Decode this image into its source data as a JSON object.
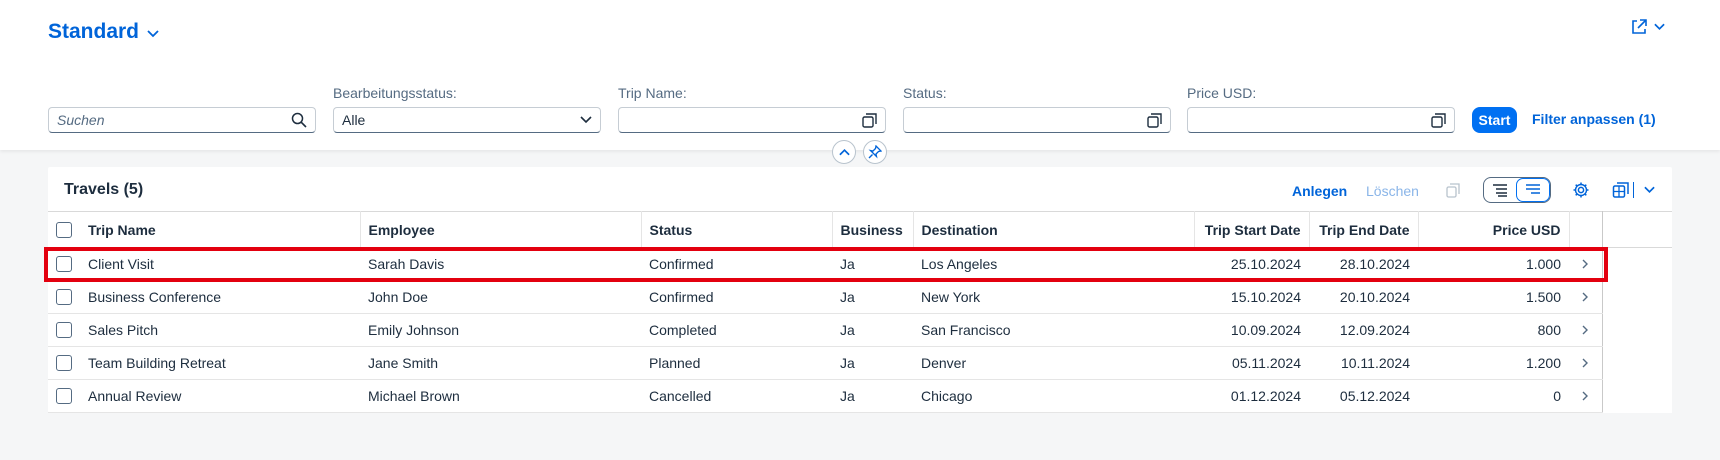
{
  "header": {
    "variant_title": "Standard",
    "share_icon": "share-icon"
  },
  "filters": {
    "search": {
      "placeholder": "Suchen"
    },
    "editing_status": {
      "label": "Bearbeitungsstatus:",
      "value": "Alle"
    },
    "trip_name": {
      "label": "Trip Name:",
      "value": ""
    },
    "status": {
      "label": "Status:",
      "value": ""
    },
    "price_usd": {
      "label": "Price USD:",
      "value": ""
    },
    "go_label": "Start",
    "adapt_label": "Filter anpassen (1)"
  },
  "table": {
    "title": "Travels (5)",
    "actions": {
      "create": "Anlegen",
      "delete": "Löschen"
    },
    "columns": [
      "Trip Name",
      "Employee",
      "Status",
      "Business",
      "Destination",
      "Trip Start Date",
      "Trip End Date",
      "Price USD"
    ],
    "rows": [
      {
        "trip_name": "Client Visit",
        "employee": "Sarah Davis",
        "status": "Confirmed",
        "business": "Ja",
        "destination": "Los Angeles",
        "start": "25.10.2024",
        "end": "28.10.2024",
        "price": "1.000"
      },
      {
        "trip_name": "Business Conference",
        "employee": "John Doe",
        "status": "Confirmed",
        "business": "Ja",
        "destination": "New York",
        "start": "15.10.2024",
        "end": "20.10.2024",
        "price": "1.500"
      },
      {
        "trip_name": "Sales Pitch",
        "employee": "Emily Johnson",
        "status": "Completed",
        "business": "Ja",
        "destination": "San Francisco",
        "start": "10.09.2024",
        "end": "12.09.2024",
        "price": "800"
      },
      {
        "trip_name": "Team Building Retreat",
        "employee": "Jane Smith",
        "status": "Planned",
        "business": "Ja",
        "destination": "Denver",
        "start": "05.11.2024",
        "end": "10.11.2024",
        "price": "1.200"
      },
      {
        "trip_name": "Annual Review",
        "employee": "Michael Brown",
        "status": "Cancelled",
        "business": "Ja",
        "destination": "Chicago",
        "start": "01.12.2024",
        "end": "05.12.2024",
        "price": "0"
      }
    ]
  },
  "colors": {
    "accent": "#0070f2",
    "link": "#0064d9",
    "highlight": "#e3000f"
  }
}
